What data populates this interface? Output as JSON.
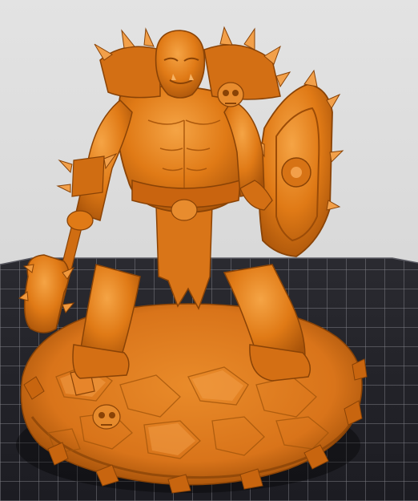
{
  "viewer": {
    "background_color": "#d8d8d8",
    "plate_color": "#25252b",
    "grid_color": "#9a9aa0",
    "model_color": "#e07a16",
    "model_shadow_color": "#9f4f06",
    "model_highlight_color": "#f4a244"
  },
  "model": {
    "name_icon": "orc-warrior-miniature",
    "parts": [
      "body",
      "head",
      "shield",
      "mace",
      "skull",
      "base"
    ]
  }
}
